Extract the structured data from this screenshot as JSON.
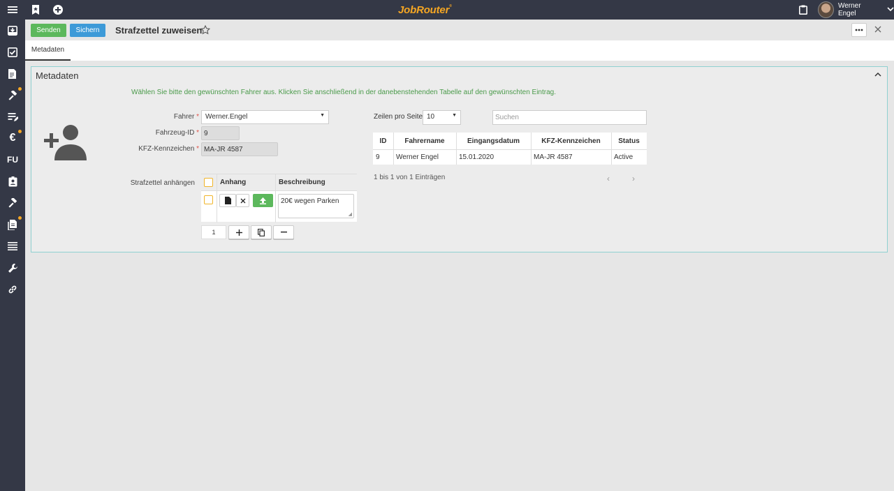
{
  "topbar": {
    "brand": "JobRouter",
    "user_name": "Werner Engel",
    "icons": [
      "menu-icon",
      "bookmark-icon",
      "add-circle-icon",
      "clipboard-icon",
      "chevron-down-icon"
    ]
  },
  "sidebar": {
    "items": [
      {
        "icon": "inbox-icon",
        "badge": false
      },
      {
        "icon": "task-check-icon",
        "badge": false
      },
      {
        "icon": "document-edit-icon",
        "badge": false
      },
      {
        "icon": "gavel-icon",
        "badge": true
      },
      {
        "icon": "form-edit-icon",
        "badge": false
      },
      {
        "icon": "euro-icon",
        "label": "€",
        "badge": true
      },
      {
        "icon": "fu-icon",
        "label": "FU",
        "badge": false
      },
      {
        "icon": "contact-card-icon",
        "badge": false
      },
      {
        "icon": "gavel-icon",
        "badge": false
      },
      {
        "icon": "documents-icon",
        "badge": true
      },
      {
        "icon": "list-icon",
        "badge": false
      },
      {
        "icon": "wrench-icon",
        "badge": false
      },
      {
        "icon": "link-icon",
        "badge": false
      }
    ]
  },
  "toolbar": {
    "send_label": "Senden",
    "save_label": "Sichern",
    "title": "Strafzettel zuweisen"
  },
  "tabs": [
    {
      "label": "Metadaten",
      "active": true
    }
  ],
  "panel": {
    "title": "Metadaten",
    "hint": "Wählen Sie bitte den gewünschten Fahrer aus. Klicken Sie anschließend in der danebenstehenden Tabelle auf den gewünschten Eintrag.",
    "fields": {
      "driver_label": "Fahrer",
      "driver_value": "Werner.Engel",
      "vehicle_id_label": "Fahrzeug-ID",
      "vehicle_id_value": "9",
      "plate_label": "KFZ-Kennzeichen",
      "plate_value": "MA-JR 4587",
      "required_mark": "*"
    },
    "attachment": {
      "label": "Strafzettel anhängen",
      "col_attachment": "Anhang",
      "col_description": "Beschreibung",
      "row_description": "20€ wegen Parken",
      "page_value": "1"
    },
    "table": {
      "rows_per_page_label": "Zeilen pro Seite",
      "rows_per_page_value": "10",
      "search_placeholder": "Suchen",
      "headers": [
        "ID",
        "Fahrername",
        "Eingangsdatum",
        "KFZ-Kennzeichen",
        "Status"
      ],
      "rows": [
        [
          "9",
          "Werner Engel",
          "15.01.2020",
          "MA-JR 4587",
          "Active"
        ]
      ],
      "info": "1 bis 1 von 1 Einträgen"
    }
  },
  "colors": {
    "topbar": "#343846",
    "send": "#5cb85c",
    "save": "#3d9ad8",
    "brand": "#f5a623",
    "panel_border": "#8fd0d0",
    "hint": "#4a9a4a"
  }
}
